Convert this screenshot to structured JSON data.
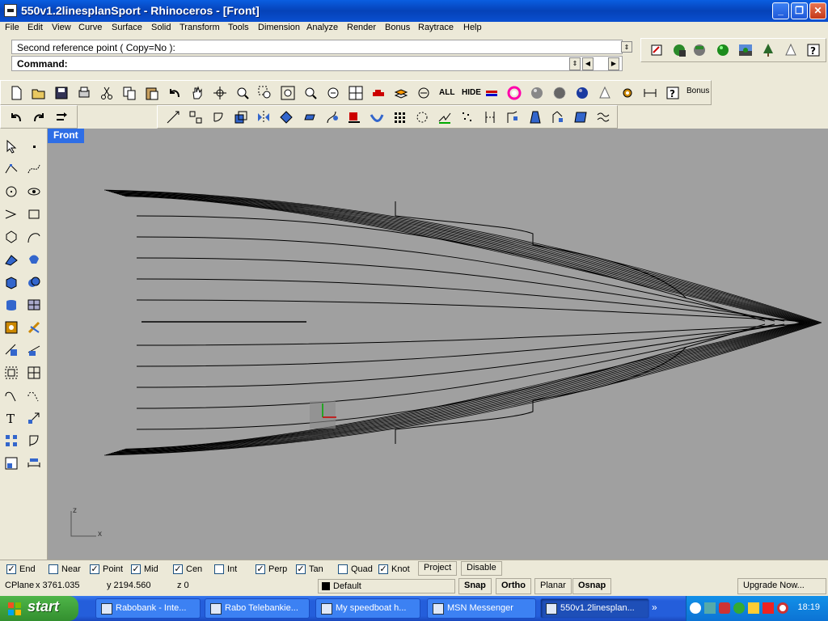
{
  "window": {
    "title": "550v1.2linesplanSport - Rhinoceros - [Front]",
    "minimize": "_",
    "restore": "❐",
    "close": "✕"
  },
  "menu": [
    "File",
    "Edit",
    "View",
    "Curve",
    "Surface",
    "Solid",
    "Transform",
    "Tools",
    "Dimension",
    "Analyze",
    "Render",
    "Bonus",
    "Raytrace",
    "Help"
  ],
  "command": {
    "prompt": "Second reference point ( Copy=No ):",
    "label": "Command:"
  },
  "toolbar": {
    "all_label": "ALL",
    "hide_label": "HIDE",
    "bonus_label": "Bonus"
  },
  "viewport": {
    "title": "Front",
    "axis_z": "z",
    "axis_x": "x",
    "line_color": "#000000",
    "background": "#a0a0a0"
  },
  "osnaps": [
    {
      "label": "End",
      "checked": true
    },
    {
      "label": "Near",
      "checked": false
    },
    {
      "label": "Point",
      "checked": true
    },
    {
      "label": "Mid",
      "checked": true
    },
    {
      "label": "Cen",
      "checked": true
    },
    {
      "label": "Int",
      "checked": false
    },
    {
      "label": "Perp",
      "checked": true
    },
    {
      "label": "Tan",
      "checked": true
    },
    {
      "label": "Quad",
      "checked": false
    },
    {
      "label": "Knot",
      "checked": true
    }
  ],
  "osnap_buttons": {
    "project": "Project",
    "disable": "Disable"
  },
  "status": {
    "cplane": "CPlane",
    "x": "x 3761.035",
    "y": "y 2194.560",
    "z": "z 0",
    "layer": "Default",
    "snap": "Snap",
    "ortho": "Ortho",
    "planar": "Planar",
    "osnap": "Osnap",
    "upgrade": "Upgrade Now..."
  },
  "taskbar": {
    "start": "start",
    "tasks": [
      "Rabobank - Inte...",
      "Rabo Telebankie...",
      "My speedboat h...",
      "MSN Messenger",
      "550v1.2linesplan..."
    ],
    "clock": "18:19",
    "more": "»"
  }
}
